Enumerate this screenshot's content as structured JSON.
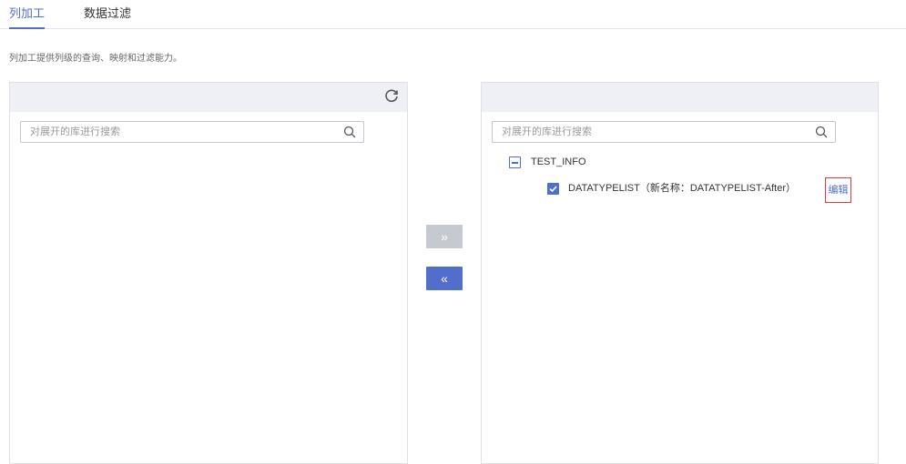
{
  "tabs": [
    {
      "label": "列加工",
      "active": true
    },
    {
      "label": "数据过滤",
      "active": false
    }
  ],
  "description": "列加工提供列级的查询、映射和过滤能力。",
  "left_panel": {
    "search_placeholder": "对展开的库进行搜索",
    "icons": [
      "refresh-icon",
      "search-icon"
    ]
  },
  "transfer": {
    "right_label": "»",
    "left_label": "«",
    "right_enabled": false,
    "left_enabled": true
  },
  "right_panel": {
    "search_placeholder": "对展开的库进行搜索",
    "tree": {
      "database": "TEST_INFO",
      "database_state": "expanded",
      "table": "DATATYPELIST（新名称：DATATYPELIST-After）",
      "table_checked": true,
      "edit_label": "编辑"
    }
  },
  "colors": {
    "accent": "#526ecc",
    "disabled_button": "#c5c9d0",
    "panel_header": "#eef0f5",
    "highlight_border": "#e03a3a"
  }
}
